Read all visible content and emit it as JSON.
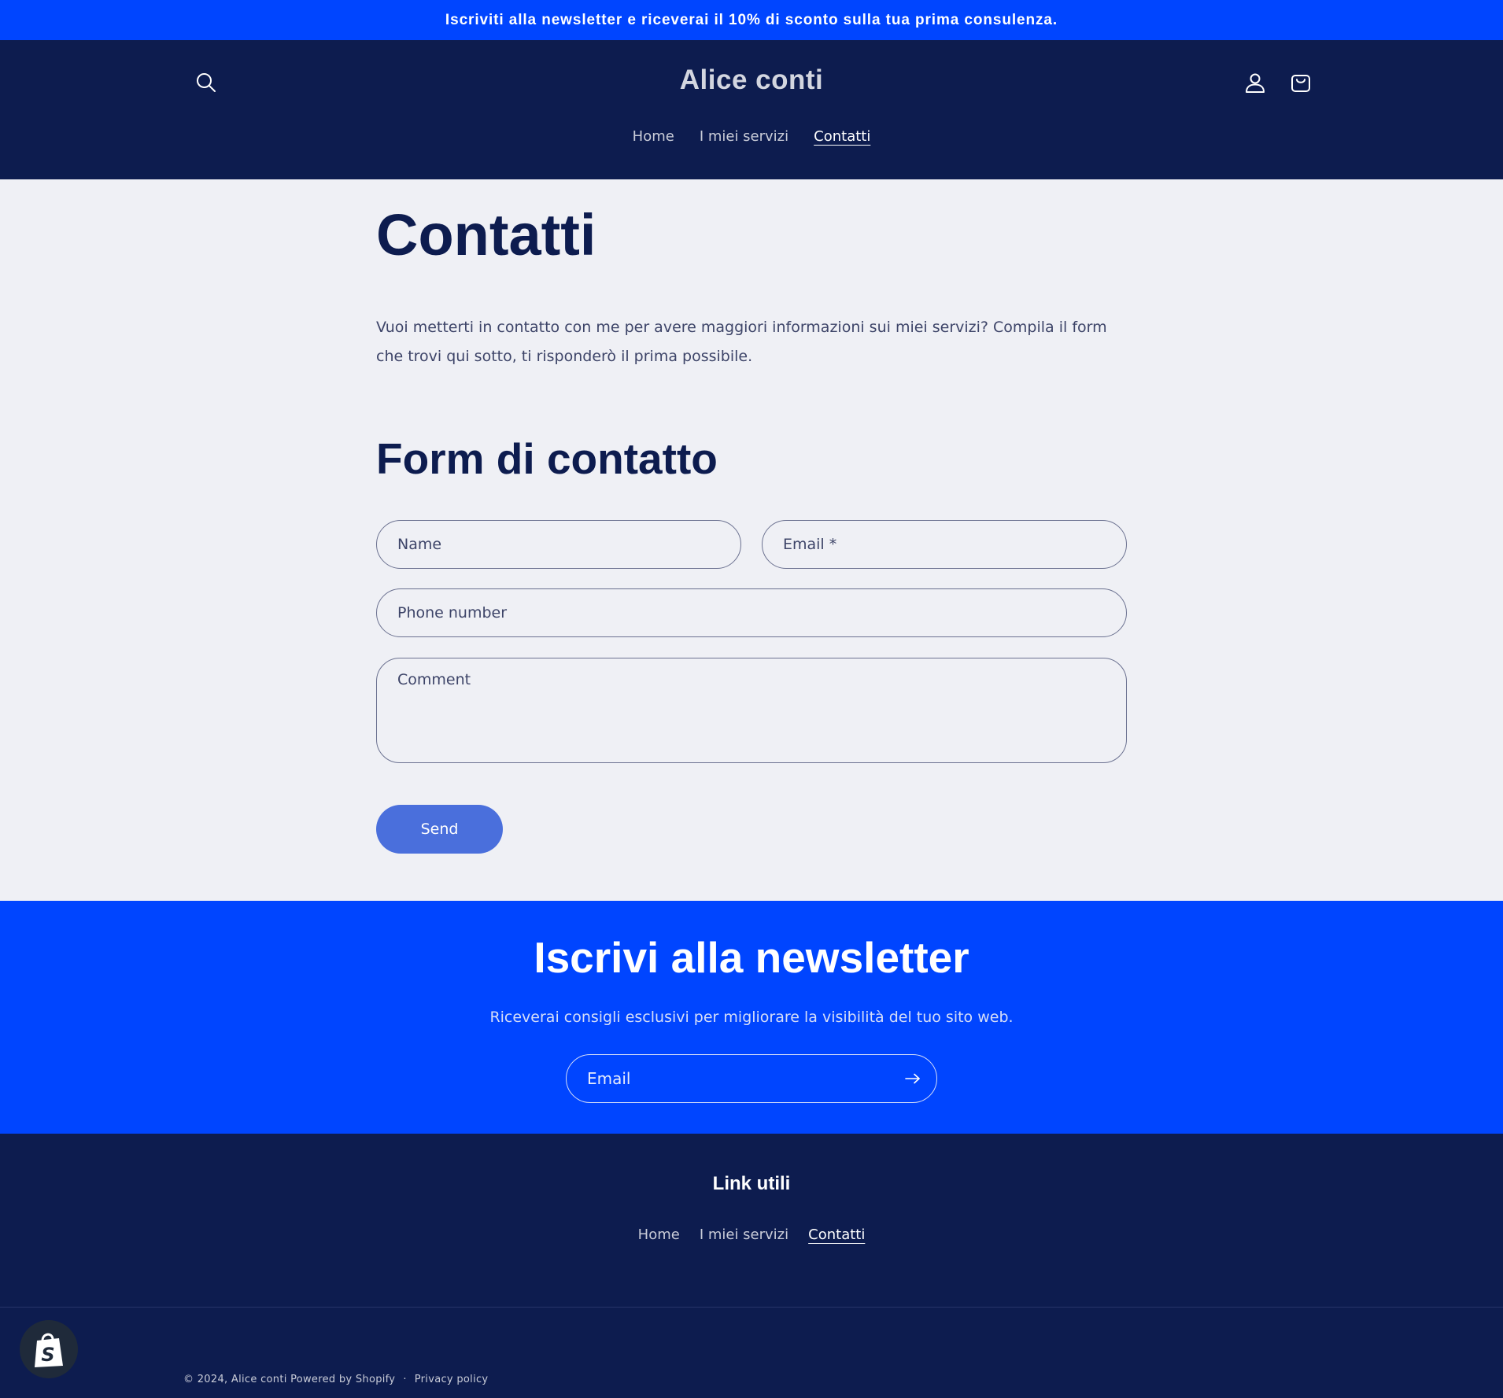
{
  "announcement": {
    "text": "Iscriviti alla newsletter e riceverai il 10% di sconto sulla tua prima consulenza."
  },
  "header": {
    "brand": "Alice conti",
    "icons": {
      "search": "search-icon",
      "account": "user-icon",
      "cart": "shopping-bag-icon"
    },
    "nav": [
      {
        "label": "Home",
        "active": false
      },
      {
        "label": "I miei servizi",
        "active": false
      },
      {
        "label": "Contatti",
        "active": true
      }
    ]
  },
  "main": {
    "title": "Contatti",
    "intro": "Vuoi metterti in contatto con me per avere maggiori informazioni sui miei servizi? Compila il form che trovi qui sotto, ti risponderò il prima possibile.",
    "form_title": "Form di contatto",
    "fields": {
      "name": {
        "placeholder": "Name",
        "value": ""
      },
      "email": {
        "placeholder": "Email *",
        "value": ""
      },
      "phone": {
        "placeholder": "Phone number",
        "value": ""
      },
      "comment": {
        "placeholder": "Comment",
        "value": ""
      }
    },
    "send_label": "Send"
  },
  "newsletter": {
    "title": "Iscrivi alla newsletter",
    "subtitle": "Riceverai consigli esclusivi per migliorare la visibilità del tuo sito web.",
    "email_placeholder": "Email",
    "submit_icon": "arrow-right-icon"
  },
  "footer": {
    "heading": "Link utili",
    "links": [
      {
        "label": "Home",
        "active": false
      },
      {
        "label": "I miei servizi",
        "active": false
      },
      {
        "label": "Contatti",
        "active": true
      }
    ],
    "copyright_prefix": "© 2024, ",
    "brand_link": "Alice conti",
    "powered_by": " Powered by Shopify",
    "separator": "·",
    "privacy": "Privacy policy",
    "badge_icon": "shopify-bag-icon"
  },
  "colors": {
    "announcement_bg": "#0045ff",
    "header_bg": "#0d1c4f",
    "page_bg": "#eff0f5",
    "send_button": "#4a6fdc"
  }
}
